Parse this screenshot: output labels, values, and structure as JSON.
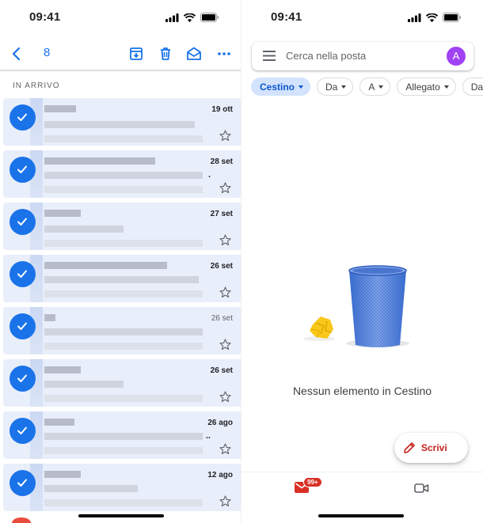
{
  "left": {
    "status_time": "09:41",
    "selected_count": "8",
    "section_label": "IN ARRIVO",
    "emails": [
      {
        "date": "19 ott",
        "unread": true,
        "dot": ""
      },
      {
        "date": "28 set",
        "unread": true,
        "dot": "."
      },
      {
        "date": "27 set",
        "unread": true,
        "dot": ""
      },
      {
        "date": "26 set",
        "unread": true,
        "dot": ""
      },
      {
        "date": "26 set",
        "unread": false,
        "dot": ""
      },
      {
        "date": "26 set",
        "unread": true,
        "dot": ""
      },
      {
        "date": "26 ago",
        "unread": true,
        "dot": ".."
      },
      {
        "date": "12 ago",
        "unread": true,
        "dot": ""
      }
    ]
  },
  "right": {
    "status_time": "09:41",
    "search_placeholder": "Cerca nella posta",
    "account_initial": "A",
    "chips": [
      "Cestino",
      "Da",
      "A",
      "Allegato",
      "Data"
    ],
    "empty_message": "Nessun elemento in Cestino",
    "compose_label": "Scrivi",
    "mail_badge": "99+"
  },
  "colors": {
    "accent": "#1a73e8",
    "selected_row": "#e9eefb",
    "compose_red": "#c5221f",
    "avatar_purple": "#a142f4"
  }
}
